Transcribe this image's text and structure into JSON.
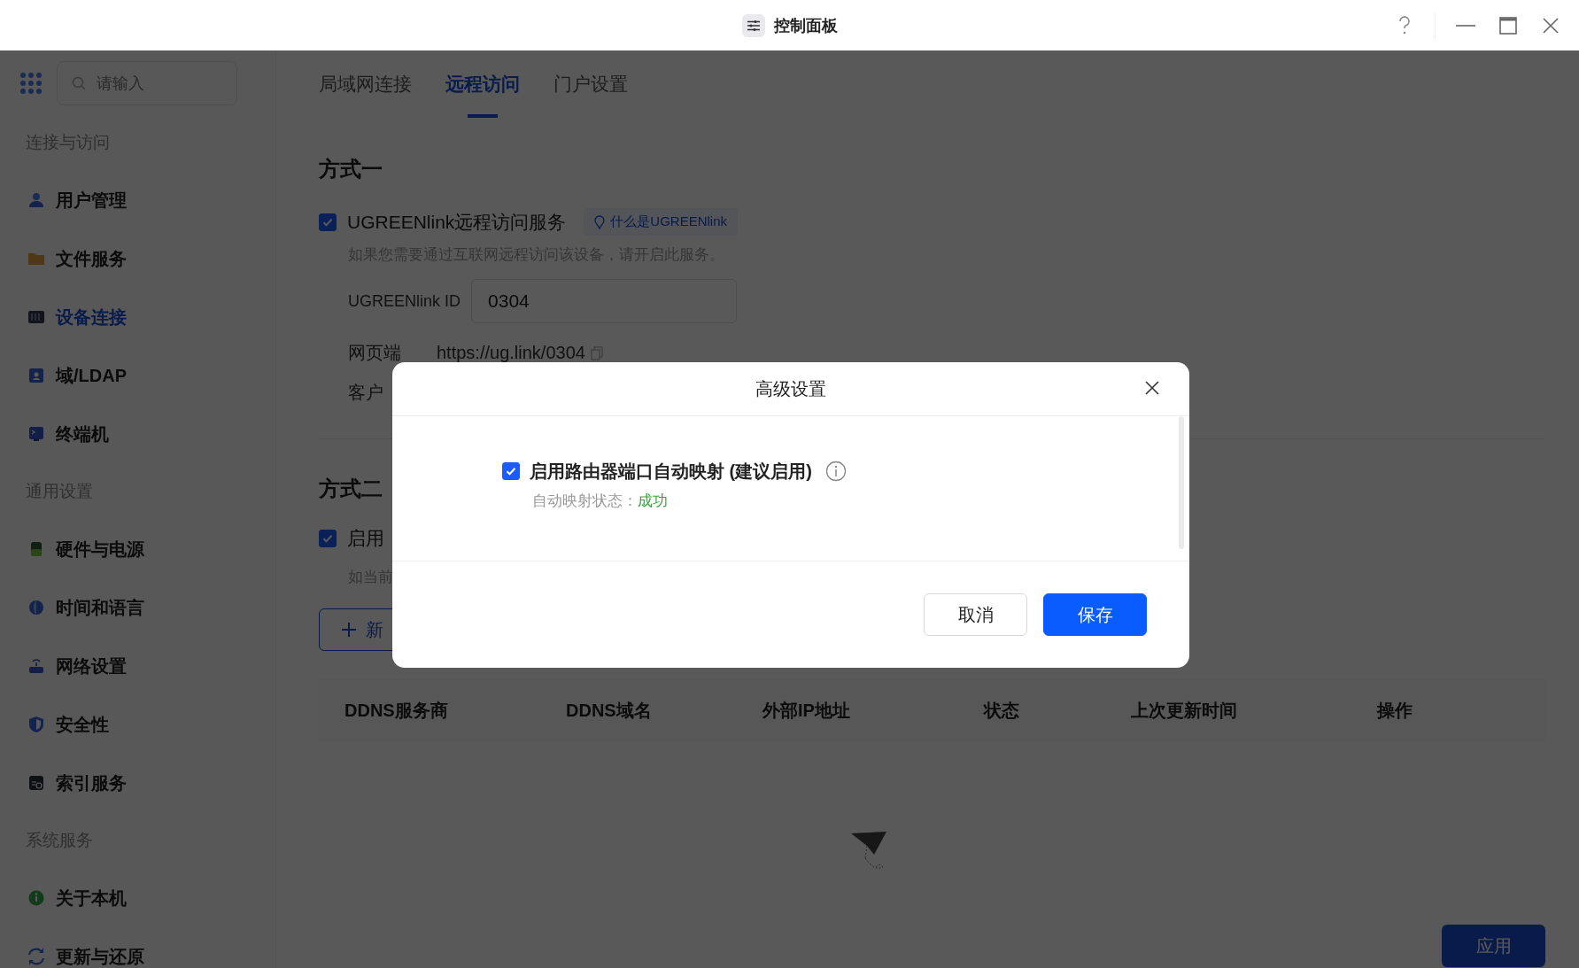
{
  "window": {
    "title": "控制面板"
  },
  "sidebar": {
    "search": {
      "placeholder": "请输入"
    },
    "groups": [
      {
        "title": "连接与访问",
        "items": [
          {
            "label": "用户管理",
            "selected": false
          },
          {
            "label": "文件服务",
            "selected": false
          },
          {
            "label": "设备连接",
            "selected": true
          },
          {
            "label": "域/LDAP",
            "selected": false
          },
          {
            "label": "终端机",
            "selected": false
          }
        ]
      },
      {
        "title": "通用设置",
        "items": [
          {
            "label": "硬件与电源",
            "selected": false
          },
          {
            "label": "时间和语言",
            "selected": false
          },
          {
            "label": "网络设置",
            "selected": false
          },
          {
            "label": "安全性",
            "selected": false
          },
          {
            "label": "索引服务",
            "selected": false
          }
        ]
      },
      {
        "title": "系统服务",
        "items": [
          {
            "label": "关于本机",
            "selected": false
          },
          {
            "label": "更新与还原",
            "selected": false
          }
        ]
      }
    ]
  },
  "tabs": [
    {
      "label": "局域网连接",
      "selected": false
    },
    {
      "label": "远程访问",
      "selected": true
    },
    {
      "label": "门户设置",
      "selected": false
    }
  ],
  "method_one": {
    "title": "方式一",
    "service": {
      "label": "UGREENlink远程访问服务",
      "checked": true,
      "help_link": "什么是UGREENlink"
    },
    "description": "如果您需要通过互联网远程访问该设备，请开启此服务。",
    "id_field": {
      "label": "UGREENlink ID",
      "value": "0304"
    },
    "web": {
      "label": "网页端",
      "url": "https://ug.link/0304"
    },
    "client": {
      "label": "客户"
    }
  },
  "method_two": {
    "title": "方式二",
    "option": {
      "label": "启用",
      "checked": true
    },
    "description": "如当前",
    "add_button": "新"
  },
  "table": {
    "columns": [
      "DDNS服务商",
      "DDNS域名",
      "外部IP地址",
      "状态",
      "上次更新时间",
      "操作"
    ]
  },
  "apply_button": "应用",
  "dialog": {
    "title": "高级设置",
    "option": {
      "label": "启用路由器端口自动映射 (建议启用)",
      "checked": true
    },
    "status": {
      "label": "自动映射状态：",
      "value": "成功"
    },
    "buttons": [
      {
        "label": "取消",
        "kind": "secondary"
      },
      {
        "label": "保存",
        "kind": "primary"
      }
    ]
  }
}
